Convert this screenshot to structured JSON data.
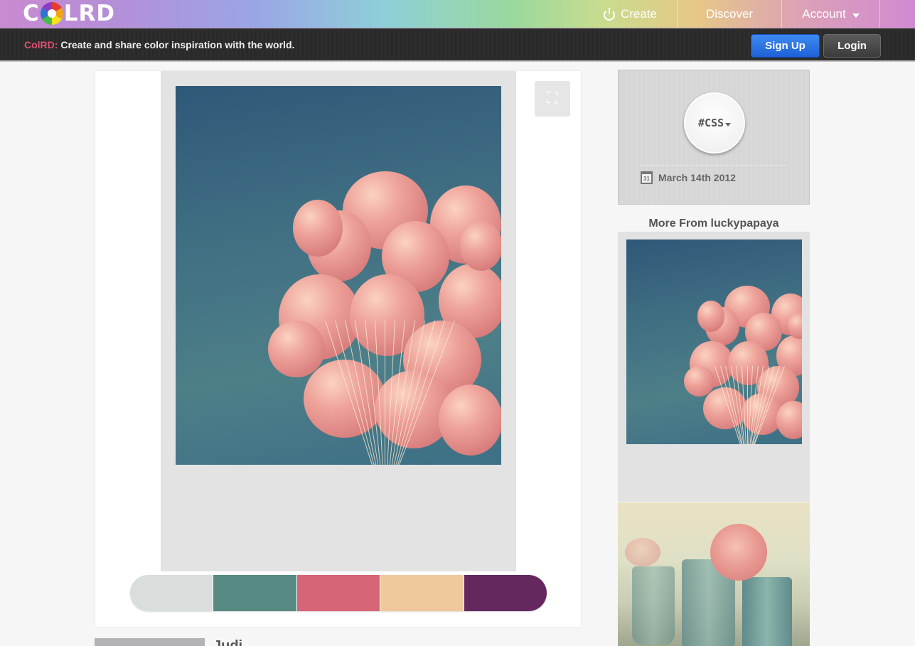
{
  "header": {
    "logo_text_left": "C",
    "logo_text_right": "LRD",
    "nav": {
      "create_label": "Create",
      "discover_label": "Discover",
      "account_label": "Account"
    }
  },
  "subbar": {
    "brand": "ColRD:",
    "tagline": "Create and share color inspiration with the world.",
    "signup_label": "Sign Up",
    "login_label": "Login"
  },
  "main": {
    "palette": [
      "#d9dddc",
      "#588a84",
      "#d66577",
      "#f0c89c",
      "#64285f"
    ],
    "below_title": "Judi..."
  },
  "sidebar": {
    "tag": "#CSS",
    "date": "March 14th 2012",
    "calendar_day": "31",
    "more_from_title": "More From luckypapaya"
  },
  "icons": {
    "power": "power-icon",
    "account_caret": "chevron-down-icon",
    "expand": "expand-icon",
    "calendar": "calendar-icon"
  },
  "colors": {
    "brand_pink": "#e04f73",
    "signup_blue": "#2a72e0",
    "login_gray": "#4a4a4a"
  }
}
